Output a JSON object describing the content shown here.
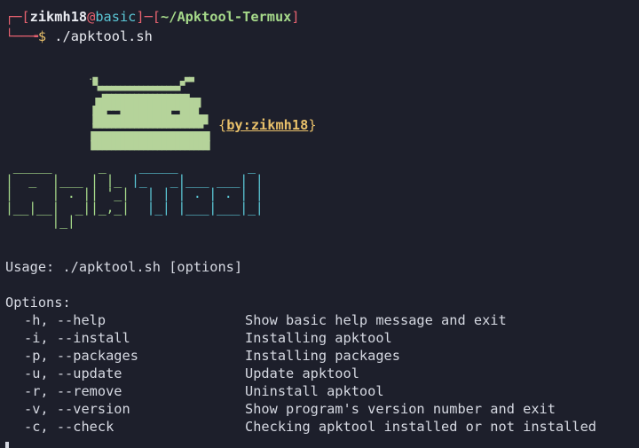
{
  "prompt": {
    "open": "┌─[",
    "user": "zikmh18",
    "at": "@",
    "host": "basic",
    "mid": "]─[",
    "path": "~/Apktool-Termux",
    "close": "]",
    "corner": "└──╼",
    "dollar": "$",
    "command": " ./apktool.sh"
  },
  "banner": {
    "droid_art": "       .▄                   ▄▄\n        ▀▄▄▄▄▄▄▄▄▄▄▄▄▄▄▄▄▄▄▀\n          ▄▄▄▄▄▄▄▄▄▄▄▄▄▄▄▄▄▄▄\n        ▐██████████████████████▌\n        ███▀▀▀███████████▀▀████\n        █████████████████████████\n        ▀▀▀▀▀▀▀▀▀▀▀▀▀▀▀▀▀▀▀▀▀▀▀▀\n       ▐█████████████████████████▌\n       ▐█████████████████████████▌",
    "by_open": "{",
    "by_text": "by:zikmh18",
    "by_close": "}",
    "apk_art": " _____      _\n|  _  |___ | |_\n|     | . || '_|\n|__|__|  _||_,_|\n      |_|",
    "tool_art": " _____         _\n|_   _|___ ___| |\n  | | | . | . | |\n  |_| |___|___|_|"
  },
  "usage": "Usage: ./apktool.sh [options]",
  "options_title": "Options:",
  "options": [
    {
      "flag": "-h, --help",
      "desc": "Show basic help message and exit"
    },
    {
      "flag": "-i, --install",
      "desc": "Installing apktool"
    },
    {
      "flag": "-p, --packages",
      "desc": "Installing packages"
    },
    {
      "flag": "-u, --update",
      "desc": "Update apktool"
    },
    {
      "flag": "-r, --remove",
      "desc": "Uninstall apktool"
    },
    {
      "flag": "-v, --version",
      "desc": "Show program's version number and exit"
    },
    {
      "flag": "-c, --check",
      "desc": "Checking apktool installed or not installed"
    }
  ],
  "colors": {
    "background": "#1d1f2b",
    "prompt_red": "#e5616f",
    "host_cyan": "#5bc7d6",
    "path_green": "#a6d98a",
    "author_yellow": "#e8c06a"
  }
}
